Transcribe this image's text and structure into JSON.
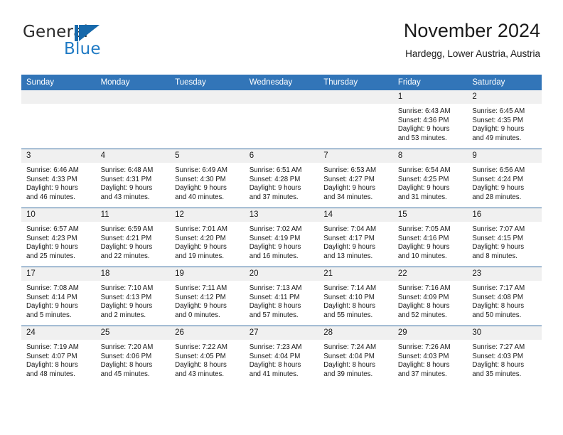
{
  "brand": {
    "name_part1": "General",
    "name_part2": "Blue",
    "mark_icon": "triangle-logo-icon",
    "color": "#1769ab"
  },
  "header": {
    "title": "November 2024",
    "subtitle": "Hardegg, Lower Austria, Austria"
  },
  "theme": {
    "header_blue": "#3275b8",
    "daynum_band": "#f0f0f0",
    "grid_line": "#31699e"
  },
  "calendar": {
    "weekday_headers": [
      "Sunday",
      "Monday",
      "Tuesday",
      "Wednesday",
      "Thursday",
      "Friday",
      "Saturday"
    ],
    "weeks": [
      [
        {
          "day": "",
          "empty": true,
          "sunrise": "",
          "sunset": "",
          "daylight_line1": "",
          "daylight_line2": ""
        },
        {
          "day": "",
          "empty": true,
          "sunrise": "",
          "sunset": "",
          "daylight_line1": "",
          "daylight_line2": ""
        },
        {
          "day": "",
          "empty": true,
          "sunrise": "",
          "sunset": "",
          "daylight_line1": "",
          "daylight_line2": ""
        },
        {
          "day": "",
          "empty": true,
          "sunrise": "",
          "sunset": "",
          "daylight_line1": "",
          "daylight_line2": ""
        },
        {
          "day": "",
          "empty": true,
          "sunrise": "",
          "sunset": "",
          "daylight_line1": "",
          "daylight_line2": ""
        },
        {
          "day": "1",
          "empty": false,
          "sunrise": "Sunrise: 6:43 AM",
          "sunset": "Sunset: 4:36 PM",
          "daylight_line1": "Daylight: 9 hours",
          "daylight_line2": "and 53 minutes."
        },
        {
          "day": "2",
          "empty": false,
          "sunrise": "Sunrise: 6:45 AM",
          "sunset": "Sunset: 4:35 PM",
          "daylight_line1": "Daylight: 9 hours",
          "daylight_line2": "and 49 minutes."
        }
      ],
      [
        {
          "day": "3",
          "empty": false,
          "sunrise": "Sunrise: 6:46 AM",
          "sunset": "Sunset: 4:33 PM",
          "daylight_line1": "Daylight: 9 hours",
          "daylight_line2": "and 46 minutes."
        },
        {
          "day": "4",
          "empty": false,
          "sunrise": "Sunrise: 6:48 AM",
          "sunset": "Sunset: 4:31 PM",
          "daylight_line1": "Daylight: 9 hours",
          "daylight_line2": "and 43 minutes."
        },
        {
          "day": "5",
          "empty": false,
          "sunrise": "Sunrise: 6:49 AM",
          "sunset": "Sunset: 4:30 PM",
          "daylight_line1": "Daylight: 9 hours",
          "daylight_line2": "and 40 minutes."
        },
        {
          "day": "6",
          "empty": false,
          "sunrise": "Sunrise: 6:51 AM",
          "sunset": "Sunset: 4:28 PM",
          "daylight_line1": "Daylight: 9 hours",
          "daylight_line2": "and 37 minutes."
        },
        {
          "day": "7",
          "empty": false,
          "sunrise": "Sunrise: 6:53 AM",
          "sunset": "Sunset: 4:27 PM",
          "daylight_line1": "Daylight: 9 hours",
          "daylight_line2": "and 34 minutes."
        },
        {
          "day": "8",
          "empty": false,
          "sunrise": "Sunrise: 6:54 AM",
          "sunset": "Sunset: 4:25 PM",
          "daylight_line1": "Daylight: 9 hours",
          "daylight_line2": "and 31 minutes."
        },
        {
          "day": "9",
          "empty": false,
          "sunrise": "Sunrise: 6:56 AM",
          "sunset": "Sunset: 4:24 PM",
          "daylight_line1": "Daylight: 9 hours",
          "daylight_line2": "and 28 minutes."
        }
      ],
      [
        {
          "day": "10",
          "empty": false,
          "sunrise": "Sunrise: 6:57 AM",
          "sunset": "Sunset: 4:23 PM",
          "daylight_line1": "Daylight: 9 hours",
          "daylight_line2": "and 25 minutes."
        },
        {
          "day": "11",
          "empty": false,
          "sunrise": "Sunrise: 6:59 AM",
          "sunset": "Sunset: 4:21 PM",
          "daylight_line1": "Daylight: 9 hours",
          "daylight_line2": "and 22 minutes."
        },
        {
          "day": "12",
          "empty": false,
          "sunrise": "Sunrise: 7:01 AM",
          "sunset": "Sunset: 4:20 PM",
          "daylight_line1": "Daylight: 9 hours",
          "daylight_line2": "and 19 minutes."
        },
        {
          "day": "13",
          "empty": false,
          "sunrise": "Sunrise: 7:02 AM",
          "sunset": "Sunset: 4:19 PM",
          "daylight_line1": "Daylight: 9 hours",
          "daylight_line2": "and 16 minutes."
        },
        {
          "day": "14",
          "empty": false,
          "sunrise": "Sunrise: 7:04 AM",
          "sunset": "Sunset: 4:17 PM",
          "daylight_line1": "Daylight: 9 hours",
          "daylight_line2": "and 13 minutes."
        },
        {
          "day": "15",
          "empty": false,
          "sunrise": "Sunrise: 7:05 AM",
          "sunset": "Sunset: 4:16 PM",
          "daylight_line1": "Daylight: 9 hours",
          "daylight_line2": "and 10 minutes."
        },
        {
          "day": "16",
          "empty": false,
          "sunrise": "Sunrise: 7:07 AM",
          "sunset": "Sunset: 4:15 PM",
          "daylight_line1": "Daylight: 9 hours",
          "daylight_line2": "and 8 minutes."
        }
      ],
      [
        {
          "day": "17",
          "empty": false,
          "sunrise": "Sunrise: 7:08 AM",
          "sunset": "Sunset: 4:14 PM",
          "daylight_line1": "Daylight: 9 hours",
          "daylight_line2": "and 5 minutes."
        },
        {
          "day": "18",
          "empty": false,
          "sunrise": "Sunrise: 7:10 AM",
          "sunset": "Sunset: 4:13 PM",
          "daylight_line1": "Daylight: 9 hours",
          "daylight_line2": "and 2 minutes."
        },
        {
          "day": "19",
          "empty": false,
          "sunrise": "Sunrise: 7:11 AM",
          "sunset": "Sunset: 4:12 PM",
          "daylight_line1": "Daylight: 9 hours",
          "daylight_line2": "and 0 minutes."
        },
        {
          "day": "20",
          "empty": false,
          "sunrise": "Sunrise: 7:13 AM",
          "sunset": "Sunset: 4:11 PM",
          "daylight_line1": "Daylight: 8 hours",
          "daylight_line2": "and 57 minutes."
        },
        {
          "day": "21",
          "empty": false,
          "sunrise": "Sunrise: 7:14 AM",
          "sunset": "Sunset: 4:10 PM",
          "daylight_line1": "Daylight: 8 hours",
          "daylight_line2": "and 55 minutes."
        },
        {
          "day": "22",
          "empty": false,
          "sunrise": "Sunrise: 7:16 AM",
          "sunset": "Sunset: 4:09 PM",
          "daylight_line1": "Daylight: 8 hours",
          "daylight_line2": "and 52 minutes."
        },
        {
          "day": "23",
          "empty": false,
          "sunrise": "Sunrise: 7:17 AM",
          "sunset": "Sunset: 4:08 PM",
          "daylight_line1": "Daylight: 8 hours",
          "daylight_line2": "and 50 minutes."
        }
      ],
      [
        {
          "day": "24",
          "empty": false,
          "sunrise": "Sunrise: 7:19 AM",
          "sunset": "Sunset: 4:07 PM",
          "daylight_line1": "Daylight: 8 hours",
          "daylight_line2": "and 48 minutes."
        },
        {
          "day": "25",
          "empty": false,
          "sunrise": "Sunrise: 7:20 AM",
          "sunset": "Sunset: 4:06 PM",
          "daylight_line1": "Daylight: 8 hours",
          "daylight_line2": "and 45 minutes."
        },
        {
          "day": "26",
          "empty": false,
          "sunrise": "Sunrise: 7:22 AM",
          "sunset": "Sunset: 4:05 PM",
          "daylight_line1": "Daylight: 8 hours",
          "daylight_line2": "and 43 minutes."
        },
        {
          "day": "27",
          "empty": false,
          "sunrise": "Sunrise: 7:23 AM",
          "sunset": "Sunset: 4:04 PM",
          "daylight_line1": "Daylight: 8 hours",
          "daylight_line2": "and 41 minutes."
        },
        {
          "day": "28",
          "empty": false,
          "sunrise": "Sunrise: 7:24 AM",
          "sunset": "Sunset: 4:04 PM",
          "daylight_line1": "Daylight: 8 hours",
          "daylight_line2": "and 39 minutes."
        },
        {
          "day": "29",
          "empty": false,
          "sunrise": "Sunrise: 7:26 AM",
          "sunset": "Sunset: 4:03 PM",
          "daylight_line1": "Daylight: 8 hours",
          "daylight_line2": "and 37 minutes."
        },
        {
          "day": "30",
          "empty": false,
          "sunrise": "Sunrise: 7:27 AM",
          "sunset": "Sunset: 4:03 PM",
          "daylight_line1": "Daylight: 8 hours",
          "daylight_line2": "and 35 minutes."
        }
      ]
    ]
  }
}
